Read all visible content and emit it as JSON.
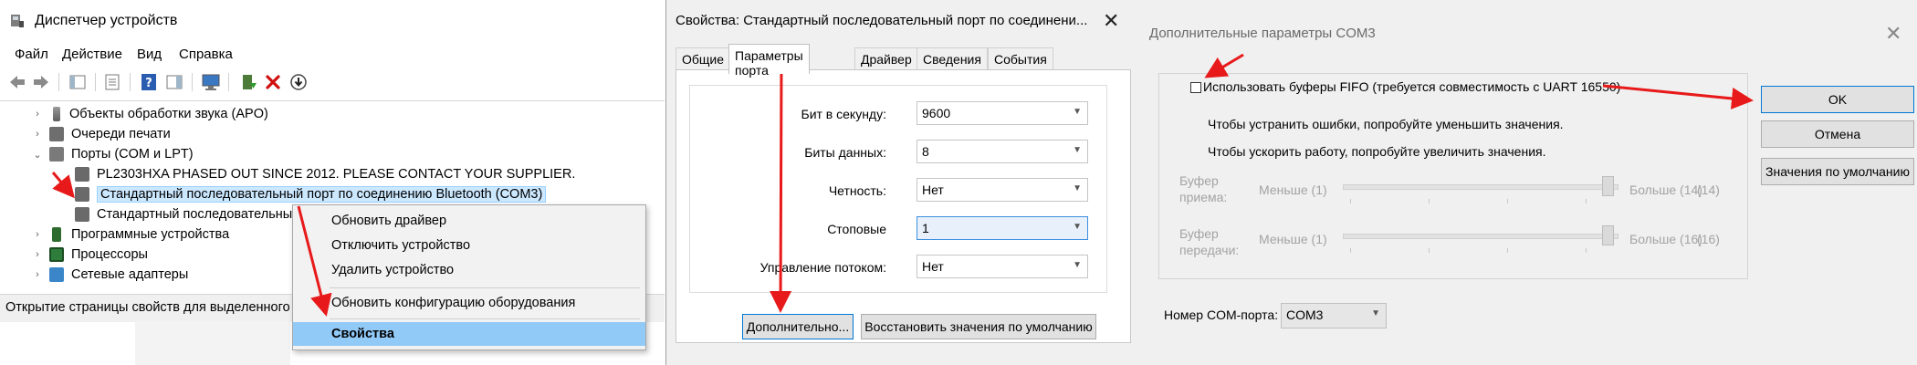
{
  "device_manager": {
    "title": "Диспетчер устройств",
    "menu": [
      "Файл",
      "Действие",
      "Вид",
      "Справка"
    ],
    "tree": [
      {
        "label": "Объекты обработки звука (APO)",
        "level": 1,
        "expander": "›"
      },
      {
        "label": "Очереди печати",
        "level": 1,
        "expander": "›"
      },
      {
        "label": "Порты (COM и LPT)",
        "level": 1,
        "expander": "⌄"
      },
      {
        "label": "PL2303HXA PHASED OUT SINCE 2012. PLEASE CONTACT YOUR SUPPLIER.",
        "level": 2,
        "expander": ""
      },
      {
        "label": "Стандартный последовательный порт по соединению Bluetooth (COM3)",
        "level": 2,
        "expander": "",
        "selected": true
      },
      {
        "label": "Стандартный последовательный",
        "level": 2,
        "expander": ""
      },
      {
        "label": "Программные устройства",
        "level": 1,
        "expander": "›"
      },
      {
        "label": "Процессоры",
        "level": 1,
        "expander": "›"
      },
      {
        "label": "Сетевые адаптеры",
        "level": 1,
        "expander": "›"
      }
    ],
    "status": "Открытие страницы свойств для выделенного о",
    "context_menu": [
      "Обновить драйвер",
      "Отключить устройство",
      "Удалить устройство",
      "Обновить конфигурацию оборудования",
      "Свойства"
    ]
  },
  "port_properties": {
    "title": "Свойства: Стандартный последовательный порт по соединени...",
    "close": "✕",
    "tabs": [
      "Общие",
      "Параметры порта",
      "Драйвер",
      "Сведения",
      "События"
    ],
    "fields": [
      {
        "label": "Бит в секунду:",
        "value": "9600"
      },
      {
        "label": "Биты данных:",
        "value": "8"
      },
      {
        "label": "Четность:",
        "value": "Нет"
      },
      {
        "label": "Стоповые",
        "value": "1"
      },
      {
        "label": "Управление потоком:",
        "value": "Нет"
      }
    ],
    "advanced_button": "Дополнительно...",
    "restore_button": "Восстановить значения по умолчанию"
  },
  "advanced": {
    "title": "Дополнительные параметры COM3",
    "close": "✕",
    "fifo_label": "Использовать буферы FIFO (требуется совместимость с UART 16550)",
    "fifo_checked": false,
    "hint1": "Чтобы устранить ошибки, попробуйте уменьшить значения.",
    "hint2": "Чтобы ускорить работу, попробуйте увеличить значения.",
    "rx": {
      "label1": "Буфер",
      "label2": "приема:",
      "min": "Меньше (1)",
      "max": "Больше (14)",
      "value": "(14)"
    },
    "tx": {
      "label1": "Буфер",
      "label2": "передачи:",
      "min": "Меньше (1)",
      "max": "Больше (16)",
      "value": "(16)"
    },
    "com_label": "Номер COM-порта:",
    "com_value": "COM3",
    "ok": "OK",
    "cancel": "Отмена",
    "defaults": "Значения по умолчанию"
  },
  "colors": {
    "annotation_arrow": "#e8191a",
    "selection": "#cce8ff",
    "menu_highlight": "#91c9f7",
    "focus_border": "#0078d7"
  }
}
